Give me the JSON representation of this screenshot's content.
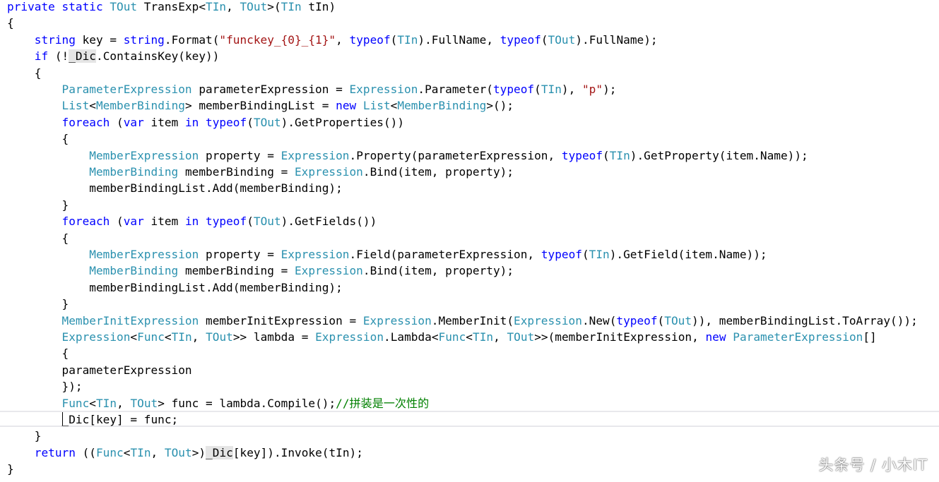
{
  "code": {
    "lines": [
      [
        {
          "t": "private static ",
          "c": "kw"
        },
        {
          "t": "TOut",
          "c": "ty"
        },
        {
          "t": " TransExp<"
        },
        {
          "t": "TIn",
          "c": "ty"
        },
        {
          "t": ", "
        },
        {
          "t": "TOut",
          "c": "ty"
        },
        {
          "t": ">("
        },
        {
          "t": "TIn",
          "c": "ty"
        },
        {
          "t": " tIn)"
        }
      ],
      [
        {
          "t": "{"
        }
      ],
      [
        {
          "t": "    "
        },
        {
          "t": "string",
          "c": "kw"
        },
        {
          "t": " key = "
        },
        {
          "t": "string",
          "c": "kw"
        },
        {
          "t": ".Format("
        },
        {
          "t": "\"funckey_{0}_{1}\"",
          "c": "st"
        },
        {
          "t": ", "
        },
        {
          "t": "typeof",
          "c": "kw"
        },
        {
          "t": "("
        },
        {
          "t": "TIn",
          "c": "ty"
        },
        {
          "t": ").FullName, "
        },
        {
          "t": "typeof",
          "c": "kw"
        },
        {
          "t": "("
        },
        {
          "t": "TOut",
          "c": "ty"
        },
        {
          "t": ").FullName);"
        }
      ],
      [
        {
          "t": "    "
        },
        {
          "t": "if",
          "c": "kw"
        },
        {
          "t": " (!"
        },
        {
          "t": "_Dic",
          "c": "hl"
        },
        {
          "t": ".ContainsKey(key))"
        }
      ],
      [
        {
          "t": "    {"
        }
      ],
      [
        {
          "t": "        "
        },
        {
          "t": "ParameterExpression",
          "c": "ty"
        },
        {
          "t": " parameterExpression = "
        },
        {
          "t": "Expression",
          "c": "ty"
        },
        {
          "t": ".Parameter("
        },
        {
          "t": "typeof",
          "c": "kw"
        },
        {
          "t": "("
        },
        {
          "t": "TIn",
          "c": "ty"
        },
        {
          "t": "), "
        },
        {
          "t": "\"p\"",
          "c": "st"
        },
        {
          "t": ");"
        }
      ],
      [
        {
          "t": "        "
        },
        {
          "t": "List",
          "c": "ty"
        },
        {
          "t": "<"
        },
        {
          "t": "MemberBinding",
          "c": "ty"
        },
        {
          "t": "> memberBindingList = "
        },
        {
          "t": "new",
          "c": "kw"
        },
        {
          "t": " "
        },
        {
          "t": "List",
          "c": "ty"
        },
        {
          "t": "<"
        },
        {
          "t": "MemberBinding",
          "c": "ty"
        },
        {
          "t": ">();"
        }
      ],
      [
        {
          "t": "        "
        },
        {
          "t": "foreach",
          "c": "kw"
        },
        {
          "t": " ("
        },
        {
          "t": "var",
          "c": "kw"
        },
        {
          "t": " item "
        },
        {
          "t": "in",
          "c": "kw"
        },
        {
          "t": " "
        },
        {
          "t": "typeof",
          "c": "kw"
        },
        {
          "t": "("
        },
        {
          "t": "TOut",
          "c": "ty"
        },
        {
          "t": ").GetProperties())"
        }
      ],
      [
        {
          "t": "        {"
        }
      ],
      [
        {
          "t": "            "
        },
        {
          "t": "MemberExpression",
          "c": "ty"
        },
        {
          "t": " property = "
        },
        {
          "t": "Expression",
          "c": "ty"
        },
        {
          "t": ".Property(parameterExpression, "
        },
        {
          "t": "typeof",
          "c": "kw"
        },
        {
          "t": "("
        },
        {
          "t": "TIn",
          "c": "ty"
        },
        {
          "t": ").GetProperty(item.Name));"
        }
      ],
      [
        {
          "t": "            "
        },
        {
          "t": "MemberBinding",
          "c": "ty"
        },
        {
          "t": " memberBinding = "
        },
        {
          "t": "Expression",
          "c": "ty"
        },
        {
          "t": ".Bind(item, property);"
        }
      ],
      [
        {
          "t": "            memberBindingList.Add(memberBinding);"
        }
      ],
      [
        {
          "t": "        }"
        }
      ],
      [
        {
          "t": "        "
        },
        {
          "t": "foreach",
          "c": "kw"
        },
        {
          "t": " ("
        },
        {
          "t": "var",
          "c": "kw"
        },
        {
          "t": " item "
        },
        {
          "t": "in",
          "c": "kw"
        },
        {
          "t": " "
        },
        {
          "t": "typeof",
          "c": "kw"
        },
        {
          "t": "("
        },
        {
          "t": "TOut",
          "c": "ty"
        },
        {
          "t": ").GetFields())"
        }
      ],
      [
        {
          "t": "        {"
        }
      ],
      [
        {
          "t": "            "
        },
        {
          "t": "MemberExpression",
          "c": "ty"
        },
        {
          "t": " property = "
        },
        {
          "t": "Expression",
          "c": "ty"
        },
        {
          "t": ".Field(parameterExpression, "
        },
        {
          "t": "typeof",
          "c": "kw"
        },
        {
          "t": "("
        },
        {
          "t": "TIn",
          "c": "ty"
        },
        {
          "t": ").GetField(item.Name));"
        }
      ],
      [
        {
          "t": "            "
        },
        {
          "t": "MemberBinding",
          "c": "ty"
        },
        {
          "t": " memberBinding = "
        },
        {
          "t": "Expression",
          "c": "ty"
        },
        {
          "t": ".Bind(item, property);"
        }
      ],
      [
        {
          "t": "            memberBindingList.Add(memberBinding);"
        }
      ],
      [
        {
          "t": "        }"
        }
      ],
      [
        {
          "t": "        "
        },
        {
          "t": "MemberInitExpression",
          "c": "ty"
        },
        {
          "t": " memberInitExpression = "
        },
        {
          "t": "Expression",
          "c": "ty"
        },
        {
          "t": ".MemberInit("
        },
        {
          "t": "Expression",
          "c": "ty"
        },
        {
          "t": ".New("
        },
        {
          "t": "typeof",
          "c": "kw"
        },
        {
          "t": "("
        },
        {
          "t": "TOut",
          "c": "ty"
        },
        {
          "t": ")), memberBindingList.ToArray());"
        }
      ],
      [
        {
          "t": "        "
        },
        {
          "t": "Expression",
          "c": "ty"
        },
        {
          "t": "<"
        },
        {
          "t": "Func",
          "c": "ty"
        },
        {
          "t": "<"
        },
        {
          "t": "TIn",
          "c": "ty"
        },
        {
          "t": ", "
        },
        {
          "t": "TOut",
          "c": "ty"
        },
        {
          "t": ">> lambda = "
        },
        {
          "t": "Expression",
          "c": "ty"
        },
        {
          "t": ".Lambda<"
        },
        {
          "t": "Func",
          "c": "ty"
        },
        {
          "t": "<"
        },
        {
          "t": "TIn",
          "c": "ty"
        },
        {
          "t": ", "
        },
        {
          "t": "TOut",
          "c": "ty"
        },
        {
          "t": ">>(memberInitExpression, "
        },
        {
          "t": "new",
          "c": "kw"
        },
        {
          "t": " "
        },
        {
          "t": "ParameterExpression",
          "c": "ty"
        },
        {
          "t": "[]"
        }
      ],
      [
        {
          "t": "        {"
        }
      ],
      [
        {
          "t": "        parameterExpression"
        }
      ],
      [
        {
          "t": "        });"
        }
      ],
      [
        {
          "t": "        "
        },
        {
          "t": "Func",
          "c": "ty"
        },
        {
          "t": "<"
        },
        {
          "t": "TIn",
          "c": "ty"
        },
        {
          "t": ", "
        },
        {
          "t": "TOut",
          "c": "ty"
        },
        {
          "t": "> func = lambda.Compile();"
        },
        {
          "t": "//拼装是一次性的",
          "c": "cm"
        }
      ],
      [
        {
          "t": "        _Dic[key] = func;"
        }
      ],
      [
        {
          "t": "    }"
        }
      ],
      [
        {
          "t": "    "
        },
        {
          "t": "return",
          "c": "kw"
        },
        {
          "t": " (("
        },
        {
          "t": "Func",
          "c": "ty"
        },
        {
          "t": "<"
        },
        {
          "t": "TIn",
          "c": "ty"
        },
        {
          "t": ", "
        },
        {
          "t": "TOut",
          "c": "ty"
        },
        {
          "t": ">)"
        },
        {
          "t": "_Dic",
          "c": "hl"
        },
        {
          "t": "[key]).Invoke(tIn);"
        }
      ],
      [
        {
          "t": "}"
        }
      ]
    ]
  },
  "watermark": "头条号 / 小木IT",
  "colors": {
    "keyword": "#0000ff",
    "type": "#2b91af",
    "string": "#a31515",
    "comment": "#008000",
    "highlight": "#e5e5e5"
  }
}
